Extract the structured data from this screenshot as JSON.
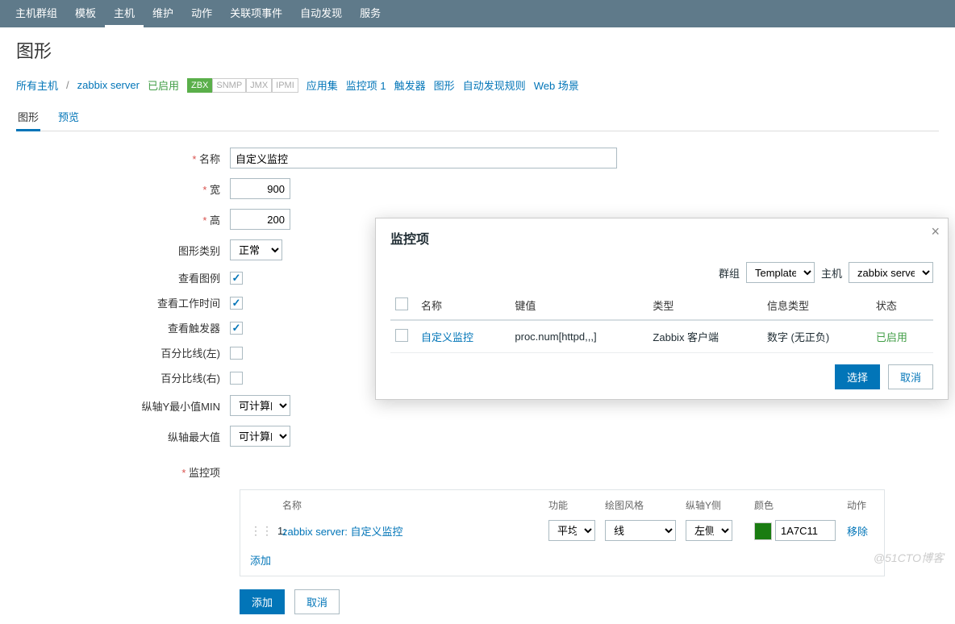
{
  "nav": {
    "items": [
      "主机群组",
      "模板",
      "主机",
      "维护",
      "动作",
      "关联项事件",
      "自动发现",
      "服务"
    ],
    "active": 2
  },
  "page_title": "图形",
  "breadcrumb": {
    "all_hosts": "所有主机",
    "host": "zabbix server",
    "status": "已启用",
    "badges": {
      "zbx": "ZBX",
      "snmp": "SNMP",
      "jmx": "JMX",
      "ipmi": "IPMI"
    },
    "links": {
      "apps": "应用集",
      "items": "监控项 1",
      "triggers": "触发器",
      "graphs": "图形",
      "discovery": "自动发现规则",
      "web": "Web 场景"
    }
  },
  "subtabs": {
    "graph": "图形",
    "preview": "预览"
  },
  "form": {
    "labels": {
      "name": "名称",
      "width": "宽",
      "height": "高",
      "graph_type": "图形类别",
      "show_legend": "查看图例",
      "show_working_time": "查看工作时间",
      "show_triggers": "查看触发器",
      "percent_left": "百分比线(左)",
      "percent_right": "百分比线(右)",
      "y_min": "纵轴Y最小值MIN",
      "y_max": "纵轴最大值",
      "items": "监控项"
    },
    "values": {
      "name": "自定义监控",
      "width": "900",
      "height": "200",
      "graph_type": "正常",
      "y_min": "可计算的",
      "y_max": "可计算的",
      "show_legend": true,
      "show_working_time": true,
      "show_triggers": true,
      "percent_left": false,
      "percent_right": false
    }
  },
  "items_table": {
    "headers": {
      "name": "名称",
      "fn": "功能",
      "style": "绘图风格",
      "side": "纵轴Y侧",
      "color": "颜色",
      "action": "动作"
    },
    "rows": [
      {
        "idx": "1:",
        "name": "zabbix server: 自定义监控",
        "fn": "平均",
        "style": "线",
        "side": "左侧",
        "color": "1A7C11",
        "remove": "移除"
      }
    ],
    "add": "添加"
  },
  "footer": {
    "add": "添加",
    "cancel": "取消"
  },
  "modal": {
    "title": "监控项",
    "filter": {
      "group_label": "群组",
      "group_value": "Templates",
      "host_label": "主机",
      "host_value": "zabbix server"
    },
    "headers": {
      "name": "名称",
      "key": "键值",
      "type": "类型",
      "info": "信息类型",
      "status": "状态"
    },
    "rows": [
      {
        "name": "自定义监控",
        "key": "proc.num[httpd,,,]",
        "type": "Zabbix 客户端",
        "info": "数字 (无正负)",
        "status": "已启用"
      }
    ],
    "select": "选择",
    "cancel": "取消"
  },
  "watermark": "@51CTO博客"
}
